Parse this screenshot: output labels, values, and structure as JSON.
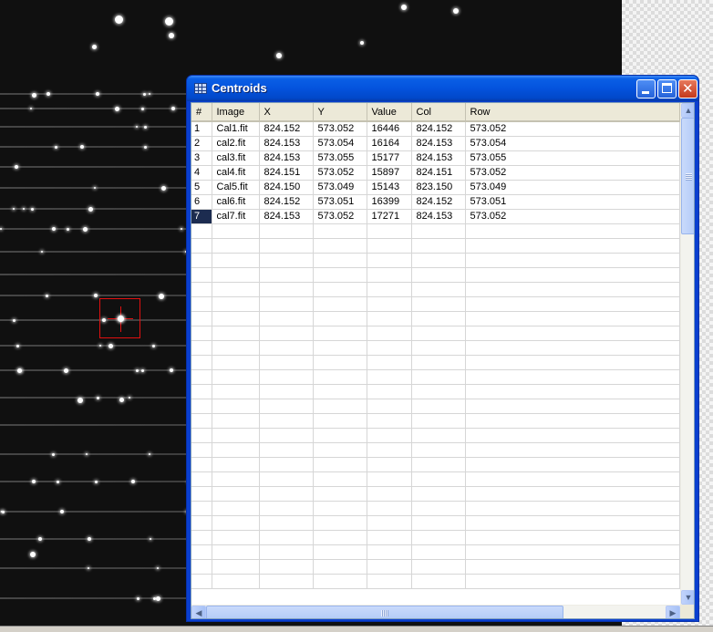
{
  "window": {
    "title": "Centroids",
    "icon": "grid-table-icon",
    "controls": [
      "minimize-icon",
      "maximize-icon",
      "close-icon"
    ],
    "close_glyph": "✕"
  },
  "table": {
    "columns": [
      "#",
      "Image",
      "X",
      "Y",
      "Value",
      "Col",
      "Row"
    ],
    "rows": [
      [
        "1",
        "Cal1.fit",
        "824.152",
        "573.052",
        "16446",
        "824.152",
        "573.052"
      ],
      [
        "2",
        "cal2.fit",
        "824.153",
        "573.054",
        "16164",
        "824.153",
        "573.054"
      ],
      [
        "3",
        "cal3.fit",
        "824.153",
        "573.055",
        "15177",
        "824.153",
        "573.055"
      ],
      [
        "4",
        "cal4.fit",
        "824.151",
        "573.052",
        "15897",
        "824.151",
        "573.052"
      ],
      [
        "5",
        "Cal5.fit",
        "824.150",
        "573.049",
        "15143",
        "823.150",
        "573.049"
      ],
      [
        "6",
        "cal6.fit",
        "824.152",
        "573.051",
        "16399",
        "824.152",
        "573.051"
      ],
      [
        "7",
        "cal7.fit",
        "824.153",
        "573.052",
        "17271",
        "824.153",
        "573.052"
      ]
    ],
    "selected_row": "7",
    "empty_rows": 25
  },
  "scrollbars": {
    "up": "▲",
    "down": "▼",
    "left": "◀",
    "right": "▶"
  },
  "colors": {
    "title_bar": "#0453dd",
    "selection": "#1c2c50",
    "marker": "#e01010"
  }
}
